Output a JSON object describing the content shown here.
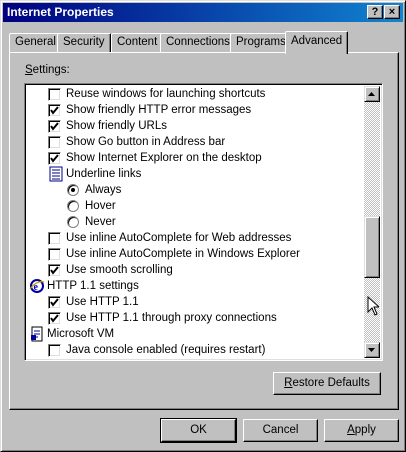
{
  "window": {
    "title": "Internet Properties",
    "help_label": "?",
    "close_label": "×"
  },
  "tabs": [
    {
      "label": "General"
    },
    {
      "label": "Security"
    },
    {
      "label": "Content"
    },
    {
      "label": "Connections"
    },
    {
      "label": "Programs"
    },
    {
      "label": "Advanced",
      "active": true
    }
  ],
  "settings_label_first": "S",
  "settings_label_rest": "ettings:",
  "settings_items": [
    {
      "type": "checkbox",
      "label": "Reuse windows for launching shortcuts",
      "checked": false,
      "indent": 1
    },
    {
      "type": "checkbox",
      "label": "Show friendly HTTP error messages",
      "checked": true,
      "indent": 1
    },
    {
      "type": "checkbox",
      "label": "Show friendly URLs",
      "checked": true,
      "indent": 1
    },
    {
      "type": "checkbox",
      "label": "Show Go button in Address bar",
      "checked": false,
      "indent": 1
    },
    {
      "type": "checkbox",
      "label": "Show Internet Explorer on the desktop",
      "checked": true,
      "indent": 1
    },
    {
      "type": "group",
      "label": "Underline links",
      "icon": "list-settings-icon",
      "indent": 1
    },
    {
      "type": "radio",
      "label": "Always",
      "checked": true,
      "indent": 2
    },
    {
      "type": "radio",
      "label": "Hover",
      "checked": false,
      "indent": 2
    },
    {
      "type": "radio",
      "label": "Never",
      "checked": false,
      "indent": 2
    },
    {
      "type": "checkbox",
      "label": "Use inline AutoComplete for Web addresses",
      "checked": false,
      "indent": 1
    },
    {
      "type": "checkbox",
      "label": "Use inline AutoComplete in Windows Explorer",
      "checked": false,
      "indent": 1
    },
    {
      "type": "checkbox",
      "label": "Use smooth scrolling",
      "checked": true,
      "indent": 1
    },
    {
      "type": "group",
      "label": "HTTP 1.1 settings",
      "icon": "internet-explorer-icon",
      "indent": 0
    },
    {
      "type": "checkbox",
      "label": "Use HTTP 1.1",
      "checked": true,
      "indent": 1
    },
    {
      "type": "checkbox",
      "label": "Use HTTP 1.1 through proxy connections",
      "checked": true,
      "indent": 1
    },
    {
      "type": "group",
      "label": "Microsoft VM",
      "icon": "java-document-icon",
      "indent": 0
    },
    {
      "type": "checkbox",
      "label": "Java console enabled (requires restart)",
      "checked": false,
      "indent": 1
    }
  ],
  "buttons": {
    "restore_defaults_first": "R",
    "restore_defaults_rest": "estore Defaults",
    "ok": "OK",
    "cancel": "Cancel",
    "apply_first": "A",
    "apply_rest": "pply"
  },
  "colors": {
    "title_start": "#000080",
    "title_end": "#1084d0",
    "face": "#c0c0c0"
  }
}
